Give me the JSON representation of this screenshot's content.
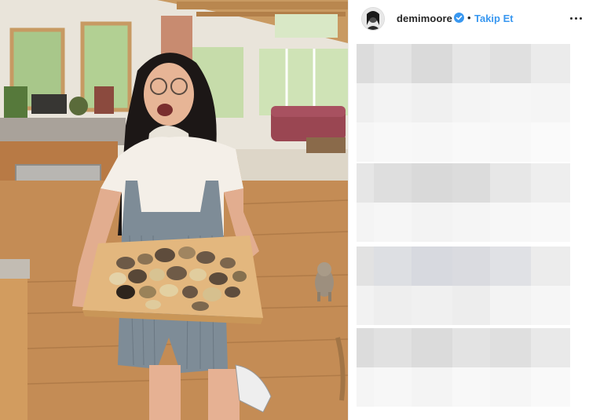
{
  "post": {
    "username": "demimoore",
    "separator": "•",
    "follow_label": "Takip Et"
  },
  "icons": {
    "verified": "verified-badge-icon",
    "more": "more-options-icon",
    "avatar": "profile-avatar"
  },
  "colors": {
    "accent": "#3897f0",
    "text": "#262626",
    "border": "#efefef"
  }
}
